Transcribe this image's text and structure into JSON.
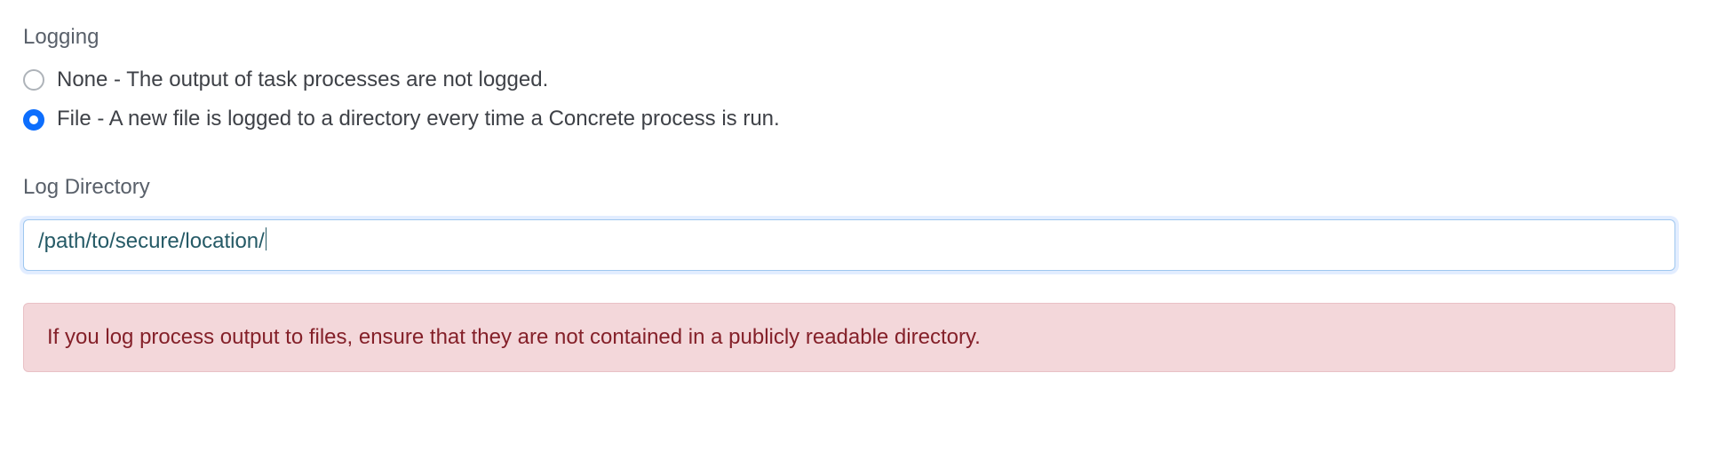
{
  "logging": {
    "heading": "Logging",
    "options": [
      {
        "label": "None - The output of task processes are not logged.",
        "checked": false
      },
      {
        "label": "File - A new file is logged to a directory every time a Concrete process is run.",
        "checked": true
      }
    ]
  },
  "log_directory": {
    "label": "Log Directory",
    "value": "/path/to/secure/location/"
  },
  "alert": {
    "message": "If you log process output to files, ensure that they are not contained in a publicly readable directory."
  }
}
